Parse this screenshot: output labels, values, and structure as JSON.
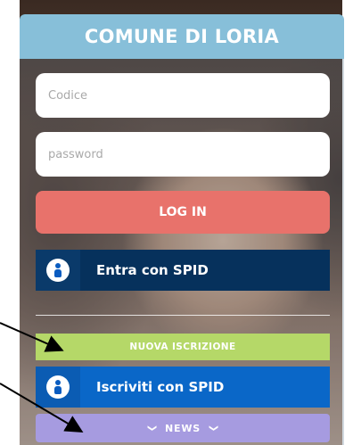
{
  "header": {
    "title": "COMUNE DI LORIA"
  },
  "form": {
    "code_placeholder": "Codice",
    "password_placeholder": "password",
    "login_label": "LOG IN"
  },
  "spid_login": {
    "label": "Entra con SPID",
    "icon": "spid-user-icon"
  },
  "nuova_iscrizione": {
    "label": "NUOVA ISCRIZIONE"
  },
  "spid_signup": {
    "label": "Iscriviti con SPID",
    "icon": "spid-user-icon"
  },
  "news": {
    "label": "NEWS",
    "chevron": "»"
  },
  "colors": {
    "header": "#87bfd9",
    "login": "#e8726b",
    "spid_login": "#06315c",
    "spid_signup": "#0a67c8",
    "nuova": "#b5d868",
    "news": "#a69be0"
  }
}
